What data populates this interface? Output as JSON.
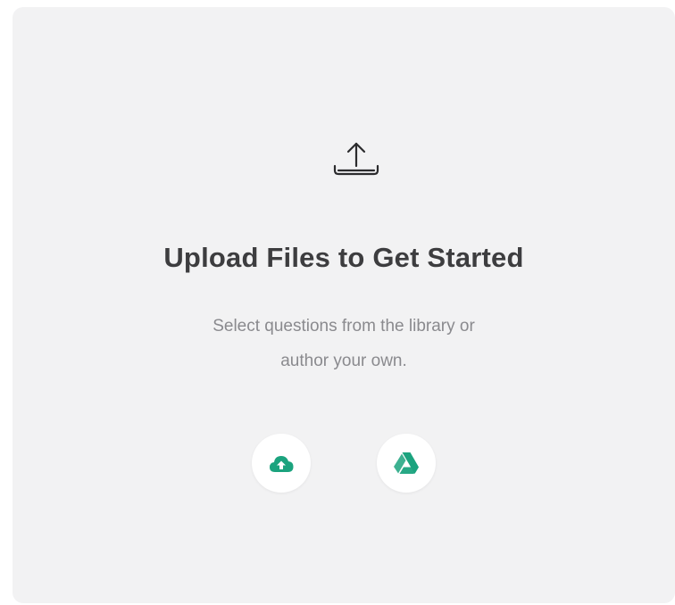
{
  "empty_state": {
    "icon": "upload-tray-icon",
    "title": "Upload Files to Get Started",
    "subtitle_line1": "Select questions from the library or",
    "subtitle_line2": "author your own."
  },
  "actions": [
    {
      "icon": "cloud-upload-icon",
      "accent": "#1ba37e"
    },
    {
      "icon": "google-drive-icon",
      "accent": "#1ba37e"
    }
  ],
  "colors": {
    "panel_bg": "#f2f2f3",
    "title": "#3d3d3f",
    "subtitle": "#8a8a8e",
    "accent": "#1ba37e"
  }
}
